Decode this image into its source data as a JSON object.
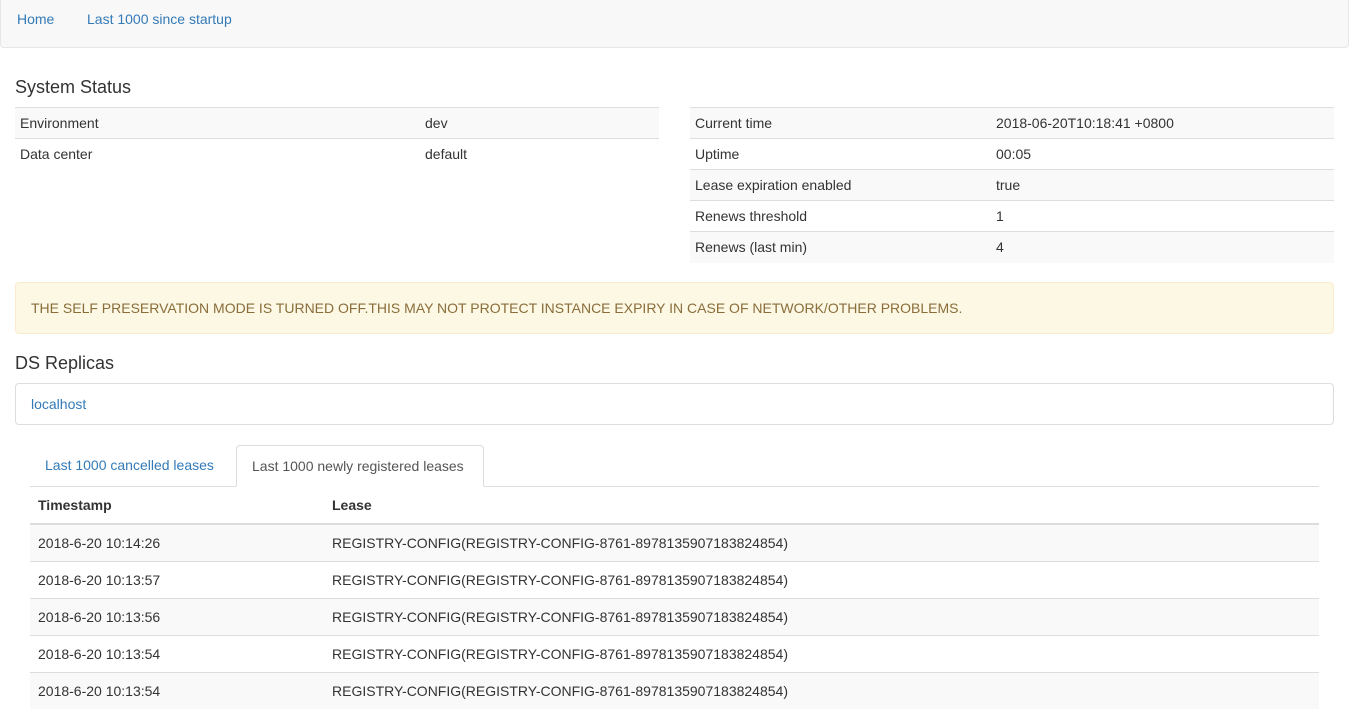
{
  "nav": {
    "home": "Home",
    "last1000": "Last 1000 since startup"
  },
  "system_status": {
    "title": "System Status",
    "left": [
      {
        "key": "Environment",
        "value": "dev"
      },
      {
        "key": "Data center",
        "value": "default"
      }
    ],
    "right": [
      {
        "key": "Current time",
        "value": "2018-06-20T10:18:41 +0800"
      },
      {
        "key": "Uptime",
        "value": "00:05"
      },
      {
        "key": "Lease expiration enabled",
        "value": "true"
      },
      {
        "key": "Renews threshold",
        "value": "1"
      },
      {
        "key": "Renews (last min)",
        "value": "4"
      }
    ]
  },
  "alert": {
    "text": "THE SELF PRESERVATION MODE IS TURNED OFF.THIS MAY NOT PROTECT INSTANCE EXPIRY IN CASE OF NETWORK/OTHER PROBLEMS."
  },
  "replicas": {
    "title": "DS Replicas",
    "items": [
      "localhost"
    ]
  },
  "tabs": [
    {
      "label": "Last 1000 cancelled leases"
    },
    {
      "label": "Last 1000 newly registered leases"
    }
  ],
  "leases": {
    "headers": {
      "timestamp": "Timestamp",
      "lease": "Lease"
    },
    "rows": [
      {
        "timestamp": "2018-6-20 10:14:26",
        "lease": "REGISTRY-CONFIG(REGISTRY-CONFIG-8761-8978135907183824854)"
      },
      {
        "timestamp": "2018-6-20 10:13:57",
        "lease": "REGISTRY-CONFIG(REGISTRY-CONFIG-8761-8978135907183824854)"
      },
      {
        "timestamp": "2018-6-20 10:13:56",
        "lease": "REGISTRY-CONFIG(REGISTRY-CONFIG-8761-8978135907183824854)"
      },
      {
        "timestamp": "2018-6-20 10:13:54",
        "lease": "REGISTRY-CONFIG(REGISTRY-CONFIG-8761-8978135907183824854)"
      },
      {
        "timestamp": "2018-6-20 10:13:54",
        "lease": "REGISTRY-CONFIG(REGISTRY-CONFIG-8761-8978135907183824854)"
      }
    ]
  }
}
